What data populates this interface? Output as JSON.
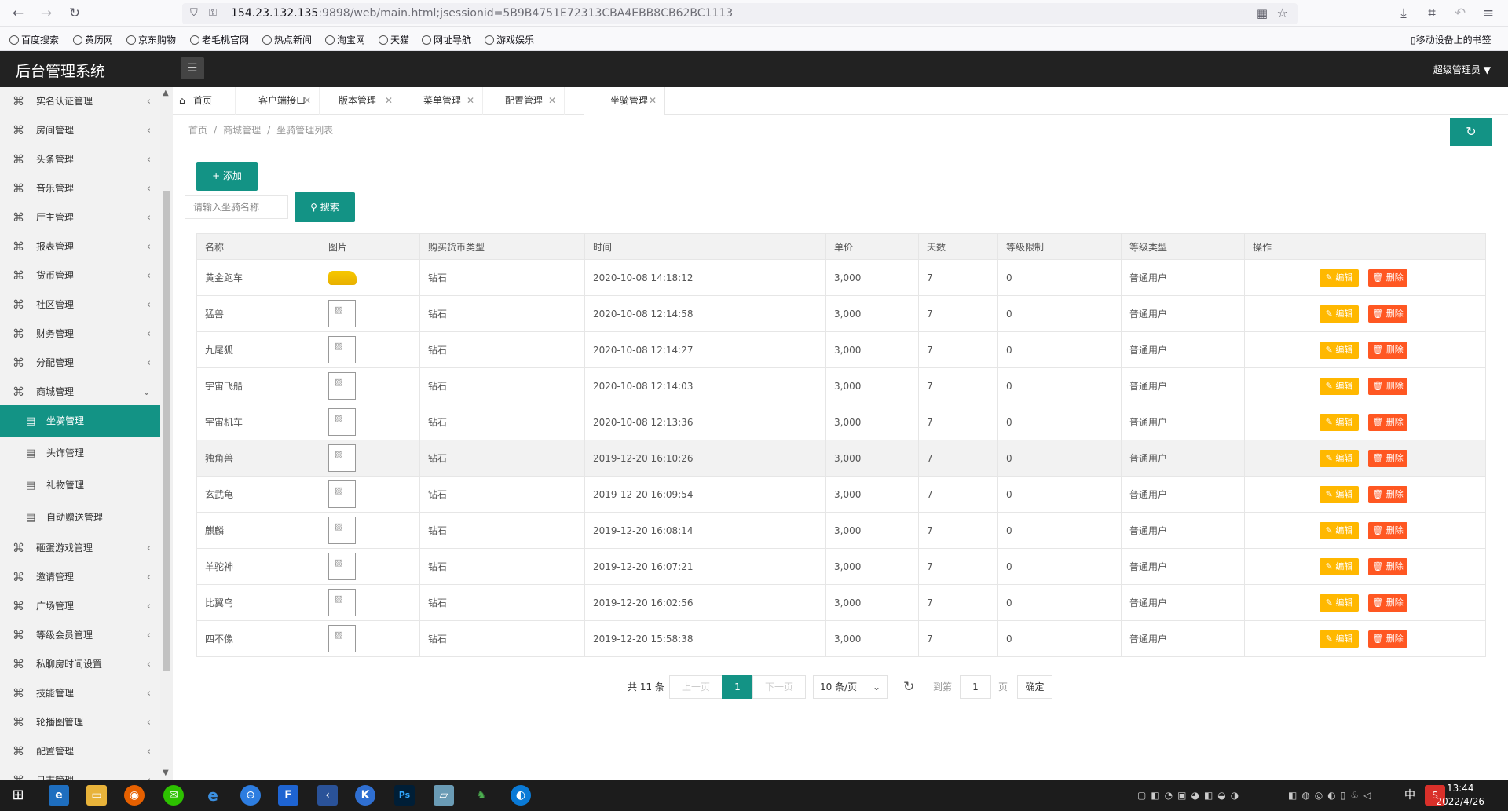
{
  "browser": {
    "url_host": "154.23.132.135",
    "url_rest": ":9898/web/main.html;jsessionid=5B9B4751E72313CBA4EBB8CB62BC1113",
    "bookmarks": [
      "百度搜索",
      "黄历网",
      "京东购物",
      "老毛桃官网",
      "热点新闻",
      "淘宝网",
      "天猫",
      "网址导航",
      "游戏娱乐"
    ],
    "mobile_bookmarks": "移动设备上的书签"
  },
  "app": {
    "title": "后台管理系统",
    "user": "超级管理员"
  },
  "sidebar": {
    "items_top": [
      "实名认证管理",
      "房间管理",
      "头条管理",
      "音乐管理",
      "厅主管理",
      "报表管理",
      "货币管理",
      "社区管理",
      "财务管理",
      "分配管理",
      "商城管理"
    ],
    "sub_items": [
      "坐骑管理",
      "头饰管理",
      "礼物管理",
      "自动赠送管理"
    ],
    "items_bottom": [
      "砸蛋游戏管理",
      "邀请管理",
      "广场管理",
      "等级会员管理",
      "私聊房时间设置",
      "技能管理",
      "轮播图管理",
      "配置管理",
      "日志管理"
    ]
  },
  "tabs": [
    "首页",
    "客户端接口",
    "版本管理",
    "菜单管理",
    "配置管理",
    "坐骑管理"
  ],
  "breadcrumb": [
    "首页",
    "商城管理",
    "坐骑管理列表"
  ],
  "toolbar": {
    "add_label": "+ 添加",
    "search_placeholder": "请输入坐骑名称",
    "search_label": "搜索"
  },
  "table": {
    "headers": [
      "名称",
      "图片",
      "购买货币类型",
      "时间",
      "单价",
      "天数",
      "等级限制",
      "等级类型",
      "操作"
    ],
    "edit_label": "编辑",
    "delete_label": "删除",
    "rows": [
      [
        "黄金跑车",
        "钻石",
        "2020-10-08 14:18:12",
        "3,000",
        "7",
        "0",
        "普通用户"
      ],
      [
        "猛兽",
        "钻石",
        "2020-10-08 12:14:58",
        "3,000",
        "7",
        "0",
        "普通用户"
      ],
      [
        "九尾狐",
        "钻石",
        "2020-10-08 12:14:27",
        "3,000",
        "7",
        "0",
        "普通用户"
      ],
      [
        "宇宙飞船",
        "钻石",
        "2020-10-08 12:14:03",
        "3,000",
        "7",
        "0",
        "普通用户"
      ],
      [
        "宇宙机车",
        "钻石",
        "2020-10-08 12:13:36",
        "3,000",
        "7",
        "0",
        "普通用户"
      ],
      [
        "独角兽",
        "钻石",
        "2019-12-20 16:10:26",
        "3,000",
        "7",
        "0",
        "普通用户"
      ],
      [
        "玄武龟",
        "钻石",
        "2019-12-20 16:09:54",
        "3,000",
        "7",
        "0",
        "普通用户"
      ],
      [
        "麒麟",
        "钻石",
        "2019-12-20 16:08:14",
        "3,000",
        "7",
        "0",
        "普通用户"
      ],
      [
        "羊驼神",
        "钻石",
        "2019-12-20 16:07:21",
        "3,000",
        "7",
        "0",
        "普通用户"
      ],
      [
        "比翼鸟",
        "钻石",
        "2019-12-20 16:02:56",
        "3,000",
        "7",
        "0",
        "普通用户"
      ],
      [
        "四不像",
        "钻石",
        "2019-12-20 15:58:38",
        "3,000",
        "7",
        "0",
        "普通用户"
      ]
    ]
  },
  "pager": {
    "total": "共 11 条",
    "prev": "上一页",
    "current": "1",
    "next": "下一页",
    "page_size": "10 条/页",
    "goto_label": "到第",
    "goto_value": "1",
    "page_unit": "页",
    "confirm": "确定"
  },
  "taskbar": {
    "time": "13:44",
    "date": "2022/4/26",
    "ime": "中"
  },
  "colors": {
    "accent": "#139385",
    "edit": "#ffb800",
    "delete": "#ff5722"
  }
}
